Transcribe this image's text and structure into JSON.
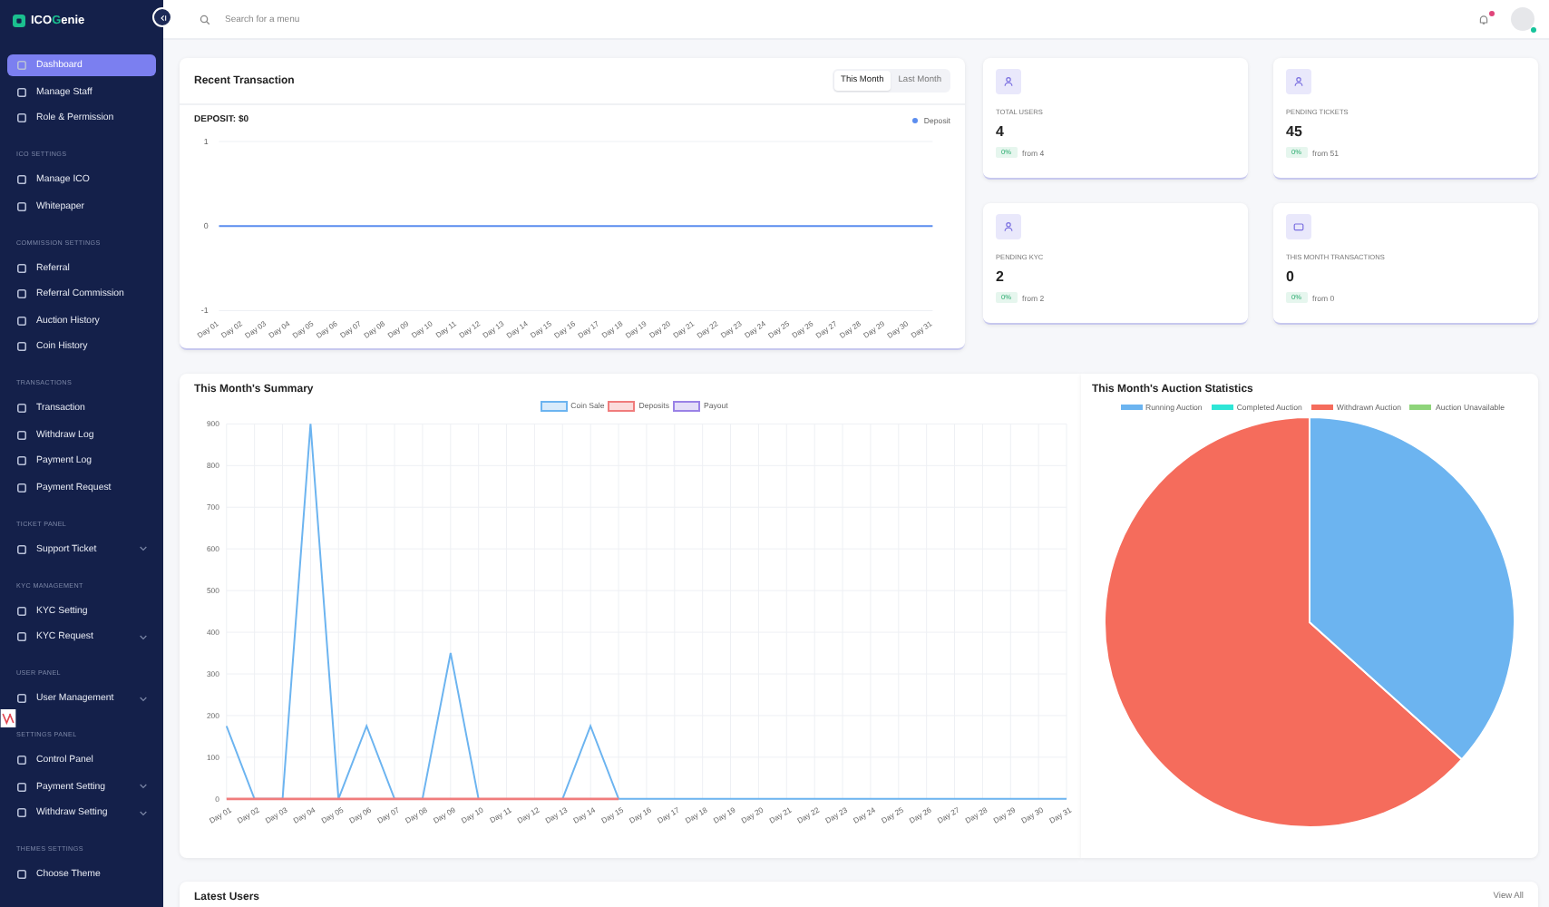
{
  "brand": {
    "name_start": "ICO",
    "name_highlight": "G",
    "name_end": "enie"
  },
  "sidebar": {
    "sections": [
      {
        "items": [
          {
            "label": "Dashboard",
            "selected": true,
            "has_submenu": false
          },
          {
            "label": "Manage Staff",
            "selected": false,
            "has_submenu": false
          },
          {
            "label": "Role & Permission",
            "selected": false,
            "has_submenu": false
          }
        ]
      },
      {
        "heading": "ICO SETTINGS",
        "items": [
          {
            "label": "Manage ICO",
            "selected": false,
            "has_submenu": false
          },
          {
            "label": "Whitepaper",
            "selected": false,
            "has_submenu": false
          }
        ]
      },
      {
        "heading": "COMMISSION SETTINGS",
        "items": [
          {
            "label": "Referral",
            "selected": false,
            "has_submenu": false
          },
          {
            "label": "Referral Commission",
            "selected": false,
            "has_submenu": false
          },
          {
            "label": "Auction History",
            "selected": false,
            "has_submenu": false
          },
          {
            "label": "Coin History",
            "selected": false,
            "has_submenu": false
          }
        ]
      },
      {
        "heading": "TRANSACTIONS",
        "items": [
          {
            "label": "Transaction",
            "selected": false,
            "has_submenu": false
          },
          {
            "label": "Withdraw Log",
            "selected": false,
            "has_submenu": false
          },
          {
            "label": "Payment Log",
            "selected": false,
            "has_submenu": false
          },
          {
            "label": "Payment Request",
            "selected": false,
            "has_submenu": false
          }
        ]
      },
      {
        "heading": "TICKET PANEL",
        "items": [
          {
            "label": "Support Ticket",
            "selected": false,
            "has_submenu": true
          }
        ]
      },
      {
        "heading": "KYC MANAGEMENT",
        "items": [
          {
            "label": "KYC Setting",
            "selected": false,
            "has_submenu": false
          },
          {
            "label": "KYC Request",
            "selected": false,
            "has_submenu": true
          }
        ]
      },
      {
        "heading": "USER PANEL",
        "items": [
          {
            "label": "User Management",
            "selected": false,
            "has_submenu": true
          }
        ]
      },
      {
        "heading": "SETTINGS PANEL",
        "items": [
          {
            "label": "Control Panel",
            "selected": false,
            "has_submenu": false
          },
          {
            "label": "Payment Setting",
            "selected": false,
            "has_submenu": true
          },
          {
            "label": "Withdraw Setting",
            "selected": false,
            "has_submenu": true
          }
        ]
      },
      {
        "heading": "THEMES SETTINGS",
        "items": [
          {
            "label": "Choose Theme",
            "selected": false,
            "has_submenu": false
          }
        ]
      }
    ]
  },
  "header": {
    "search": {
      "placeholder": "Search for a menu"
    },
    "notifications_unread": true,
    "user_online": true
  },
  "recent_transaction": {
    "title": "Recent Transaction",
    "periods": [
      {
        "label": "This Month",
        "selected": true
      },
      {
        "label": "Last Month",
        "selected": false
      }
    ],
    "total": "DEPOSIT: $0",
    "chart_data": {
      "type": "line",
      "x": [
        "Day 01",
        "Day 02",
        "Day 03",
        "Day 04",
        "Day 05",
        "Day 06",
        "Day 07",
        "Day 08",
        "Day 09",
        "Day 10",
        "Day 11",
        "Day 12",
        "Day 13",
        "Day 14",
        "Day 15",
        "Day 16",
        "Day 17",
        "Day 18",
        "Day 19",
        "Day 20",
        "Day 21",
        "Day 22",
        "Day 23",
        "Day 24",
        "Day 25",
        "Day 26",
        "Day 27",
        "Day 28",
        "Day 29",
        "Day 30",
        "Day 31"
      ],
      "ylim": [
        -1,
        1
      ],
      "yticks": [
        -1,
        0,
        1
      ],
      "series": [
        {
          "name": "Deposit",
          "color": "#5b8def",
          "values": [
            0,
            0,
            0,
            0,
            0,
            0,
            0,
            0,
            0,
            0,
            0,
            0,
            0,
            0,
            0,
            0,
            0,
            0,
            0,
            0,
            0,
            0,
            0,
            0,
            0,
            0,
            0,
            0,
            0,
            0,
            0
          ]
        }
      ]
    }
  },
  "stats": [
    {
      "label": "TOTAL USERS",
      "value": "4",
      "change": "0%",
      "from": "from 4"
    },
    {
      "label": "PENDING TICKETS",
      "value": "45",
      "change": "0%",
      "from": "from 51"
    },
    {
      "label": "PENDING KYC",
      "value": "2",
      "change": "0%",
      "from": "from 2"
    },
    {
      "label": "THIS MONTH TRANSACTIONS",
      "value": "0",
      "change": "0%",
      "from": "from 0"
    }
  ],
  "summary": {
    "title": "This Month's Summary",
    "chart_data": {
      "type": "line",
      "x": [
        "Day 01",
        "Day 02",
        "Day 03",
        "Day 04",
        "Day 05",
        "Day 06",
        "Day 07",
        "Day 08",
        "Day 09",
        "Day 10",
        "Day 11",
        "Day 12",
        "Day 13",
        "Day 14",
        "Day 15",
        "Day 16",
        "Day 17",
        "Day 18",
        "Day 19",
        "Day 20",
        "Day 21",
        "Day 22",
        "Day 23",
        "Day 24",
        "Day 25",
        "Day 26",
        "Day 27",
        "Day 28",
        "Day 29",
        "Day 30",
        "Day 31"
      ],
      "ylim": [
        0,
        900
      ],
      "yticks": [
        0,
        100,
        200,
        300,
        400,
        500,
        600,
        700,
        800,
        900
      ],
      "series": [
        {
          "name": "Coin Sale",
          "color": "#6cb4f0",
          "values": [
            175,
            0,
            0,
            900,
            0,
            175,
            0,
            0,
            350,
            0,
            null,
            null,
            0,
            175,
            0,
            0,
            0,
            0,
            0,
            0,
            0,
            0,
            0,
            0,
            0,
            0,
            0,
            0,
            0,
            0,
            0
          ]
        },
        {
          "name": "Deposits",
          "color": "#f07c7c",
          "values": [
            0,
            0,
            0,
            0,
            0,
            0,
            0,
            0,
            0,
            0,
            0,
            0,
            0,
            0,
            0,
            null,
            null,
            null,
            null,
            null,
            null,
            null,
            null,
            null,
            null,
            null,
            null,
            null,
            null,
            null,
            null
          ]
        },
        {
          "name": "Payout",
          "color": "#9a82e6",
          "values": [
            null,
            null,
            null,
            null,
            null,
            null,
            null,
            null,
            null,
            null,
            null,
            null,
            null,
            null,
            null,
            null,
            null,
            null,
            null,
            null,
            null,
            null,
            null,
            null,
            null,
            null,
            null,
            null,
            null,
            null,
            null
          ]
        }
      ],
      "grid": true
    }
  },
  "auction": {
    "title": "This Month's Auction Statistics",
    "legend": [
      {
        "label": "Running Auction",
        "color": "#6cb4f0"
      },
      {
        "label": "Completed Auction",
        "color": "#2ee6d6"
      },
      {
        "label": "Withdrawn Auction",
        "color": "#f56c5c"
      },
      {
        "label": "Auction Unavailable",
        "color": "#8ed47a"
      }
    ]
  },
  "latest_users": {
    "title": "Latest Users",
    "link": "View All"
  }
}
